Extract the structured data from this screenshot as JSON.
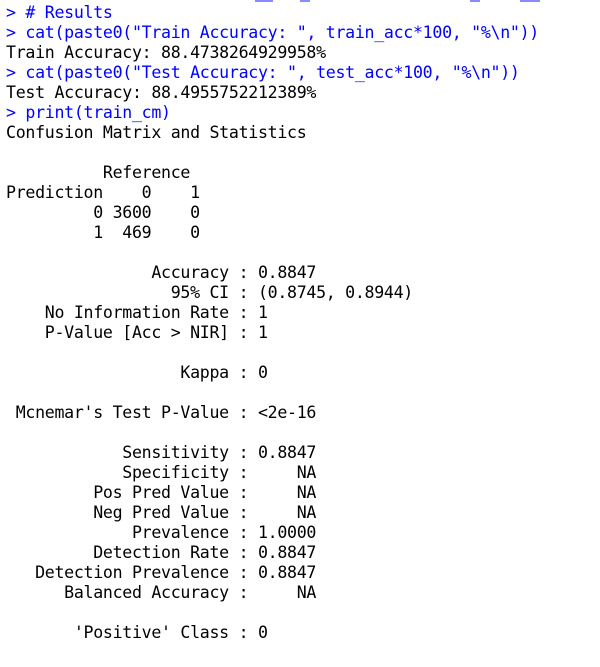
{
  "console": {
    "lines": [
      {
        "type": "cmd",
        "text": "> # Results"
      },
      {
        "type": "cmd",
        "text": "> cat(paste0(\"Train Accuracy: \", train_acc*100, \"%\\n\"))"
      },
      {
        "type": "out",
        "text": "Train Accuracy: 88.4738264929958%"
      },
      {
        "type": "cmd",
        "text": "> cat(paste0(\"Test Accuracy: \", test_acc*100, \"%\\n\"))"
      },
      {
        "type": "out",
        "text": "Test Accuracy: 88.4955752212389%"
      },
      {
        "type": "cmd",
        "text": "> print(train_cm)"
      },
      {
        "type": "out",
        "text": "Confusion Matrix and Statistics"
      },
      {
        "type": "out",
        "text": ""
      },
      {
        "type": "out",
        "text": "          Reference"
      },
      {
        "type": "out",
        "text": "Prediction    0    1"
      },
      {
        "type": "out",
        "text": "         0 3600    0"
      },
      {
        "type": "out",
        "text": "         1  469    0"
      },
      {
        "type": "out",
        "text": ""
      },
      {
        "type": "out",
        "text": "               Accuracy : 0.8847"
      },
      {
        "type": "out",
        "text": "                 95% CI : (0.8745, 0.8944)"
      },
      {
        "type": "out",
        "text": "    No Information Rate : 1"
      },
      {
        "type": "out",
        "text": "    P-Value [Acc > NIR] : 1"
      },
      {
        "type": "out",
        "text": ""
      },
      {
        "type": "out",
        "text": "                  Kappa : 0"
      },
      {
        "type": "out",
        "text": ""
      },
      {
        "type": "out",
        "text": " Mcnemar's Test P-Value : <2e-16"
      },
      {
        "type": "out",
        "text": ""
      },
      {
        "type": "out",
        "text": "            Sensitivity : 0.8847"
      },
      {
        "type": "out",
        "text": "            Specificity :     NA"
      },
      {
        "type": "out",
        "text": "         Pos Pred Value :     NA"
      },
      {
        "type": "out",
        "text": "         Neg Pred Value :     NA"
      },
      {
        "type": "out",
        "text": "             Prevalence : 1.0000"
      },
      {
        "type": "out",
        "text": "         Detection Rate : 0.8847"
      },
      {
        "type": "out",
        "text": "   Detection Prevalence : 0.8847"
      },
      {
        "type": "out",
        "text": "      Balanced Accuracy :     NA"
      },
      {
        "type": "out",
        "text": ""
      },
      {
        "type": "out",
        "text": "       'Positive' Class : 0"
      }
    ]
  },
  "colors": {
    "command": "#0000ff",
    "output": "#000000",
    "background": "#ffffff"
  }
}
